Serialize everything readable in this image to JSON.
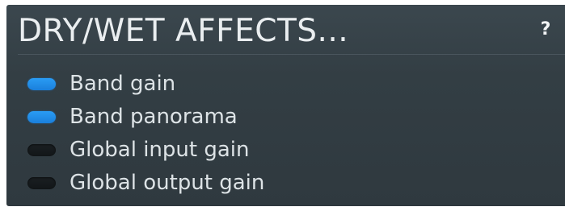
{
  "section": {
    "title": "DRY/WET AFFECTS...",
    "help_label": "?"
  },
  "options": [
    {
      "label": "Band gain",
      "checked": true
    },
    {
      "label": "Band panorama",
      "checked": true
    },
    {
      "label": "Global input gain",
      "checked": false
    },
    {
      "label": "Global output gain",
      "checked": false
    }
  ],
  "colors": {
    "panel_background": "#333e44",
    "toggle_on": "#1f8be8",
    "toggle_off": "#15191b",
    "text": "#dde3e6"
  }
}
